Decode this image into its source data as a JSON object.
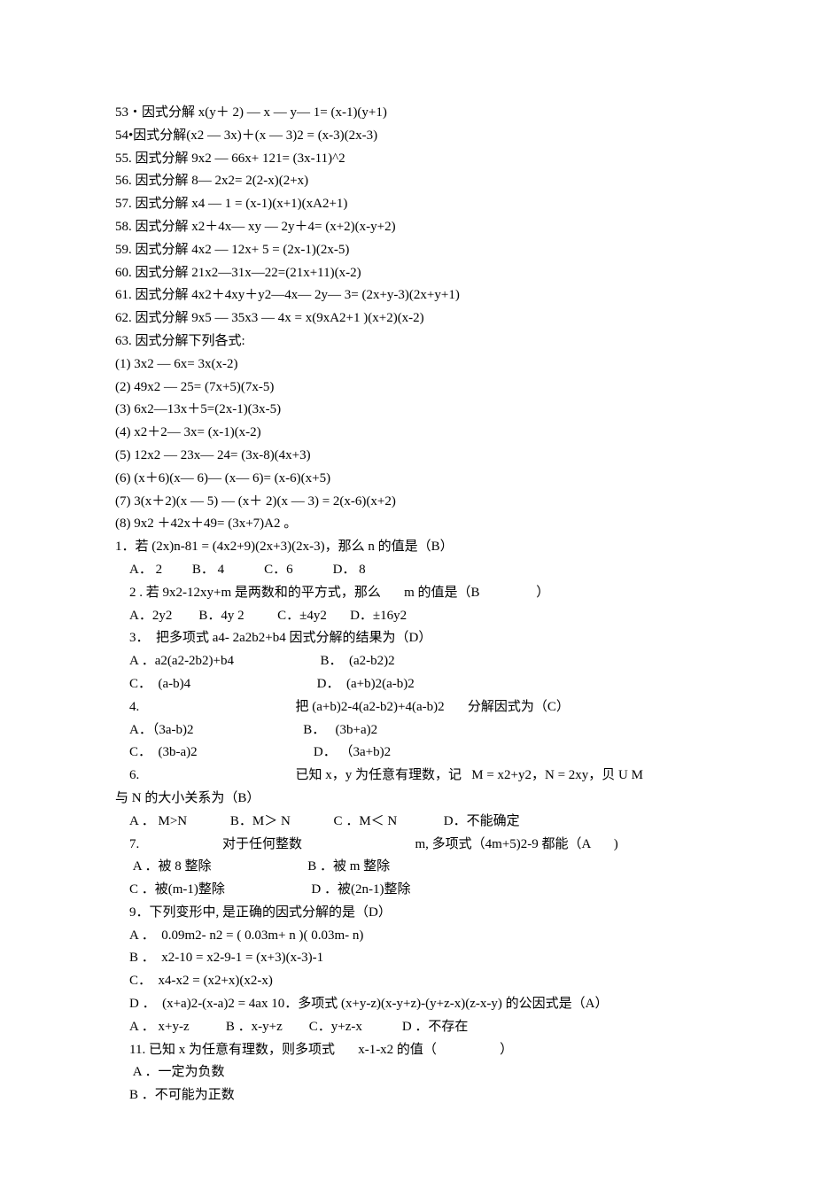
{
  "lines": [
    {
      "text": "53・因式分解 x(y＋ 2) — x — y— 1= (x-1)(y+1)"
    },
    {
      "text": "54•因式分解(x2 — 3x)＋(x — 3)2 = (x-3)(2x-3)"
    },
    {
      "text": "55. 因式分解 9x2 — 66x+ 121= (3x-11)^2"
    },
    {
      "text": "56. 因式分解 8— 2x2= 2(2-x)(2+x)"
    },
    {
      "text": "57. 因式分解 x4 — 1 = (x-1)(x+1)(xA2+1)"
    },
    {
      "text": "58. 因式分解 x2＋4x— xy — 2y＋4= (x+2)(x-y+2)"
    },
    {
      "text": "59. 因式分解 4x2 — 12x+ 5 = (2x-1)(2x-5)"
    },
    {
      "text": "60. 因式分解 21x2—31x—22=(21x+11)(x-2)"
    },
    {
      "text": "61. 因式分解 4x2＋4xy＋y2—4x— 2y— 3= (2x+y-3)(2x+y+1)"
    },
    {
      "text": "62. 因式分解 9x5 — 35x3 — 4x = x(9xA2+1 )(x+2)(x-2)"
    },
    {
      "text": "63. 因式分解下列各式:"
    },
    {
      "text": "(1) 3x2 — 6x= 3x(x-2)"
    },
    {
      "text": "(2) 49x2 — 25= (7x+5)(7x-5)"
    },
    {
      "text": "(3) 6x2—13x＋5=(2x-1)(3x-5)"
    },
    {
      "text": "(4) x2＋2— 3x= (x-1)(x-2)"
    },
    {
      "text": "(5) 12x2 — 23x— 24= (3x-8)(4x+3)"
    },
    {
      "text": "(6) (x＋6)(x— 6)— (x— 6)= (x-6)(x+5)"
    },
    {
      "text": "(7) 3(x＋2)(x — 5) — (x＋ 2)(x — 3) = 2(x-6)(x+2)"
    },
    {
      "text": "(8) 9x2 ＋42x＋49= (3x+7)A2 。"
    },
    {
      "text": "1．若 (2x)n-81 = (4x2+9)(2x+3)(2x-3)，那么 n 的值是（B）"
    },
    {
      "text": "A． 2         B． 4            C．6            D． 8",
      "indent": 1
    },
    {
      "text": "2 . 若 9x2-12xy+m 是两数和的平方式，那么       m 的值是（B                 ）",
      "indent": 1
    },
    {
      "text": "A．2y2        B．4y 2          C．±4y2       D．±16y2",
      "indent": 1
    },
    {
      "text": "3．  把多项式 a4- 2a2b2+b4 因式分解的结果为（D）",
      "indent": 1
    },
    {
      "text": "A ．a2(a2-2b2)+b4                          B．  (a2-b2)2",
      "indent": 1
    },
    {
      "text": "C．  (a-b)4                                      D．  (a+b)2(a-b)2",
      "indent": 1
    },
    {
      "text": "4.                                               把 (a+b)2-4(a2-b2)+4(a-b)2       分解因式为（C）",
      "indent": 1
    },
    {
      "text": "A．（3a-b)2                                 B．   (3b+a)2",
      "indent": 1
    },
    {
      "text": "C．  (3b-a)2                                   D． （3a+b)2",
      "indent": 1
    },
    {
      "text": "6.                                               已知 x，y 为任意有理数，记   M = x2+y2，N = 2xy，贝 U M",
      "indent": 1
    },
    {
      "text": "与 N 的大小关系为（B）"
    },
    {
      "text": "A ． M>N             B．M＞ N             C ．M＜ N              D．不能确定",
      "indent": 1
    },
    {
      "text": "7.                         对于任何整数                                  m, 多项式（4m+5)2-9 都能（A       )",
      "indent": 1
    },
    {
      "text": " A ．被 8 整除                             B ．被 m 整除",
      "indent": 1
    },
    {
      "text": "C ．被(m-1)整除                          D ．被(2n-1)整除",
      "indent": 1
    },
    {
      "text": "9．下列变形中, 是正确的因式分解的是（D）",
      "indent": 1
    },
    {
      "text": "A ．  0.09m2- n2 = ( 0.03m+ n )( 0.03m- n)",
      "indent": 1
    },
    {
      "text": "B ．  x2-10 = x2-9-1 = (x+3)(x-3)-1",
      "indent": 1
    },
    {
      "text": "C．  x4-x2 = (x2+x)(x2-x)",
      "indent": 1
    },
    {
      "text": "D ．  (x+a)2-(x-a)2 = 4ax 10．多项式 (x+y-z)(x-y+z)-(y+z-x)(z-x-y) 的公因式是（A）",
      "indent": 1
    },
    {
      "text": "A ． x+y-z           B ．x-y+z        C．y+z-x            D ．不存在",
      "indent": 1
    },
    {
      "text": "11. 已知 x 为任意有理数，则多项式       x-1-x2 的值（                   ）",
      "indent": 1
    },
    {
      "text": " A ．一定为负数",
      "indent": 1
    },
    {
      "text": "B ．不可能为正数",
      "indent": 1
    }
  ]
}
